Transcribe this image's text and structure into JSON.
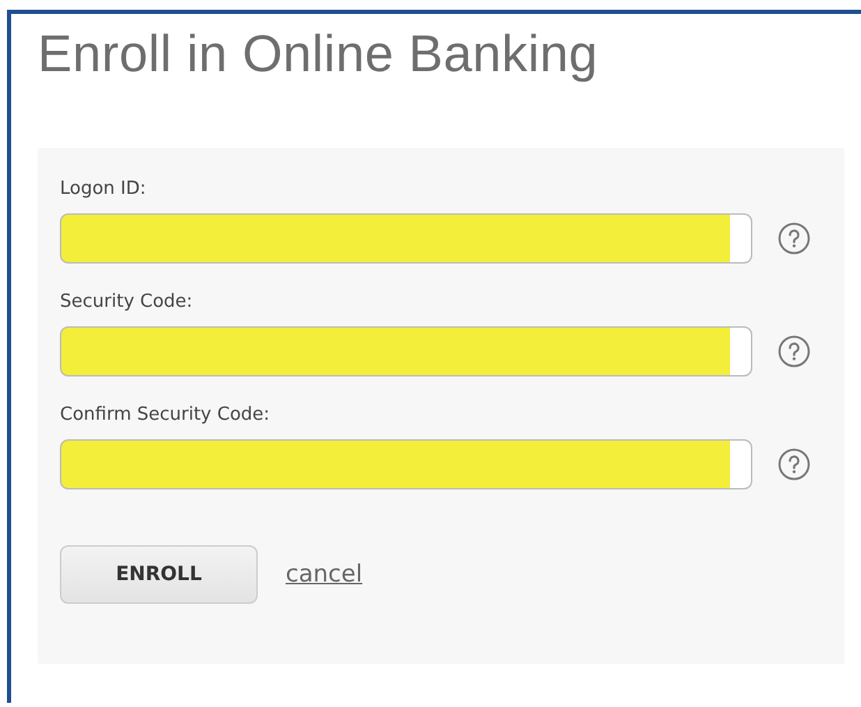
{
  "title": "Enroll in Online Banking",
  "fields": [
    {
      "label": "Logon ID:",
      "highlighted": true
    },
    {
      "label": "Security Code:",
      "highlighted": true
    },
    {
      "label": "Confirm Security Code:",
      "highlighted": true
    }
  ],
  "submit_button": "ENROLL",
  "cancel_link": "cancel"
}
